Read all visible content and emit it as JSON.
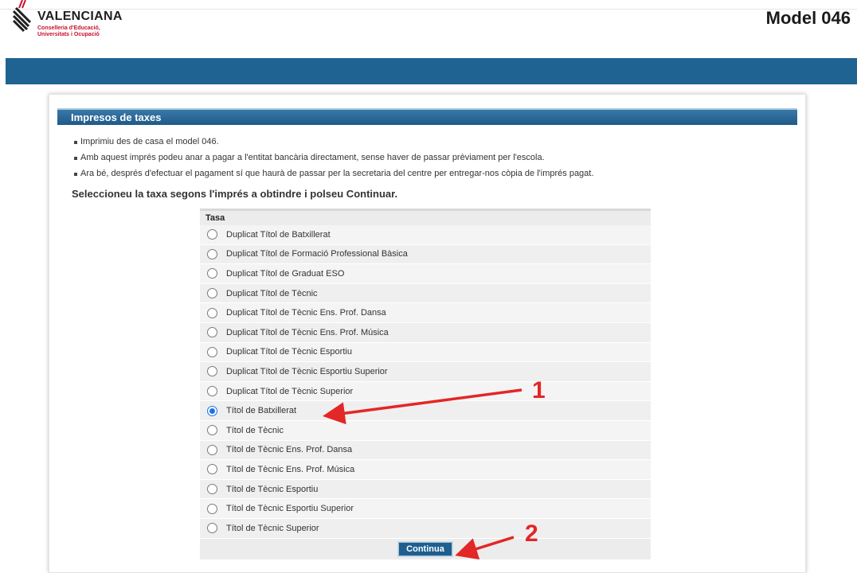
{
  "header": {
    "logo_name": "VALENCIANA",
    "logo_subtitle_line1": "Conselleria d'Educació,",
    "logo_subtitle_line2": "Universitats i Ocupació",
    "model_title": "Model 046"
  },
  "panel": {
    "title": "Impresos de taxes",
    "info": [
      "Imprimiu des de casa el model 046.",
      "Amb aquest imprés podeu anar a pagar a l'entitat bancària directament, sense haver de passar prèviament per l'escola.",
      "Ara bé, després d'efectuar el pagament sí que haurà de passar per la secretaria del centre per entregar-nos còpia de l'imprés pagat."
    ],
    "instruction": "Seleccioneu la taxa segons l'imprés a obtindre i polseu Continuar."
  },
  "table": {
    "header": "Tasa",
    "options": [
      {
        "label": "Duplicat Títol de Batxillerat",
        "checked": false
      },
      {
        "label": "Duplicat Títol de Formació Professional Bàsica",
        "checked": false
      },
      {
        "label": "Duplicat Títol de Graduat ESO",
        "checked": false
      },
      {
        "label": "Duplicat Títol de Tècnic",
        "checked": false
      },
      {
        "label": "Duplicat Títol de Tècnic Ens. Prof. Dansa",
        "checked": false
      },
      {
        "label": "Duplicat Títol de Tècnic Ens. Prof. Música",
        "checked": false
      },
      {
        "label": "Duplicat Títol de Tècnic Esportiu",
        "checked": false
      },
      {
        "label": "Duplicat Títol de Tècnic Esportiu Superior",
        "checked": false
      },
      {
        "label": "Duplicat Títol de Tècnic Superior",
        "checked": false
      },
      {
        "label": "Títol de Batxillerat",
        "checked": true
      },
      {
        "label": "Títol de Tècnic",
        "checked": false
      },
      {
        "label": "Títol de Tècnic Ens. Prof. Dansa",
        "checked": false
      },
      {
        "label": "Títol de Tècnic Ens. Prof. Música",
        "checked": false
      },
      {
        "label": "Títol de Tècnic Esportiu",
        "checked": false
      },
      {
        "label": "Títol de Tècnic Esportiu Superior",
        "checked": false
      },
      {
        "label": "Títol de Tècnic Superior",
        "checked": false
      }
    ],
    "button_label": "Continua"
  },
  "annotations": {
    "marker1": "1",
    "marker2": "2",
    "arrow_color": "#e32626"
  },
  "colors": {
    "banner": "#1f6392",
    "panel_header": "#1e5a88",
    "radio_selected": "#1a73e8"
  }
}
